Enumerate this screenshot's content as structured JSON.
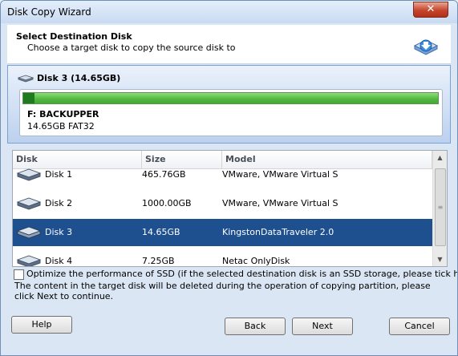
{
  "window": {
    "title": "Disk Copy Wizard",
    "close_glyph": "✕"
  },
  "header": {
    "title": "Select Destination Disk",
    "subtitle": "Choose a target disk to copy the source disk to",
    "icon": "disk-copy-icon"
  },
  "selected_disk": {
    "title": "Disk 3 (14.65GB)",
    "partition": {
      "label": "F: BACKUPPER",
      "info": "14.65GB FAT32",
      "used_fraction": 0.025,
      "bar_color": "#4fb83d"
    }
  },
  "disk_list": {
    "columns": [
      "Disk",
      "Size",
      "Model"
    ],
    "rows": [
      {
        "disk": "Disk 1",
        "size": "465.76GB",
        "model": "VMware, VMware Virtual S",
        "selected": false
      },
      {
        "disk": "Disk 2",
        "size": "1000.00GB",
        "model": "VMware, VMware Virtual S",
        "selected": false
      },
      {
        "disk": "Disk 3",
        "size": "14.65GB",
        "model": "KingstonDataTraveler 2.0",
        "selected": true
      },
      {
        "disk": "Disk 4",
        "size": "7.25GB",
        "model": "Netac  OnlyDisk",
        "selected": false
      }
    ],
    "selection_color": "#1e4f8e"
  },
  "ssd_option": {
    "label": "Optimize the performance of SSD (if the selected destination disk is an SSD storage, please tick here)",
    "checked": false
  },
  "warning": "The content in the target disk will be deleted during the operation of copying partition, please click Next to continue.",
  "buttons": {
    "help": "Help",
    "back": "Back",
    "next": "Next",
    "cancel": "Cancel"
  }
}
